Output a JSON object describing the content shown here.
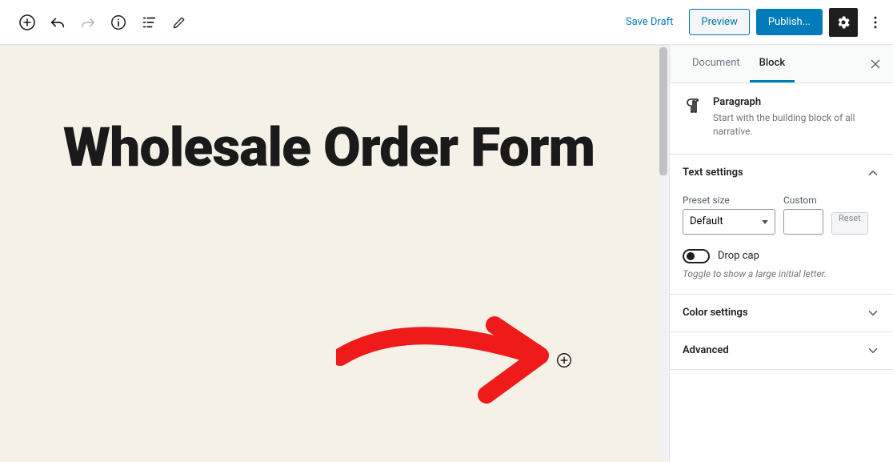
{
  "toolbar": {
    "save_draft": "Save Draft",
    "preview": "Preview",
    "publish": "Publish..."
  },
  "editor": {
    "title": "Wholesale Order Form"
  },
  "sidebar": {
    "tabs": {
      "document": "Document",
      "block": "Block"
    },
    "block": {
      "name": "Paragraph",
      "description": "Start with the building block of all narrative."
    },
    "text_settings": {
      "title": "Text settings",
      "preset_label": "Preset size",
      "preset_value": "Default",
      "custom_label": "Custom",
      "reset": "Reset",
      "dropcap_label": "Drop cap",
      "dropcap_help": "Toggle to show a large initial letter."
    },
    "color_settings": {
      "title": "Color settings"
    },
    "advanced": {
      "title": "Advanced"
    }
  }
}
